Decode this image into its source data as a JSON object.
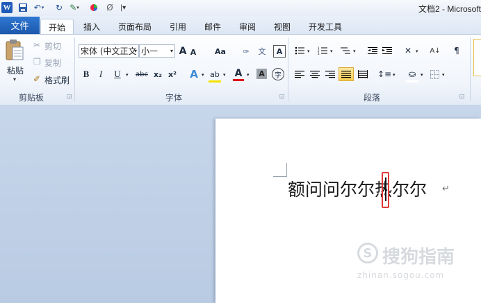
{
  "window": {
    "title": "文档2 - Microsoft"
  },
  "quick_access": {
    "logo": "W"
  },
  "tabs": {
    "file": "文件",
    "items": [
      "开始",
      "插入",
      "页面布局",
      "引用",
      "邮件",
      "审阅",
      "视图",
      "开发工具"
    ]
  },
  "clipboard": {
    "paste": "粘贴",
    "cut": "剪切",
    "copy": "复制",
    "format_painter": "格式刷",
    "group": "剪贴板"
  },
  "font": {
    "name": "宋体 (中文正文",
    "size": "小一",
    "group": "字体",
    "grow": "A",
    "shrink": "A",
    "change_case": "Aa",
    "bold": "B",
    "italic": "I",
    "underline": "U",
    "strike": "abc",
    "sub": "x₂",
    "sup": "x²",
    "color_a": "A",
    "shade_a": "A",
    "enclose": "字"
  },
  "paragraph": {
    "group": "段落"
  },
  "document": {
    "text": "额问问尔尔热尔尔"
  },
  "watermark": {
    "main": "搜狗指南",
    "sub": "zhinan.sogou.com"
  }
}
